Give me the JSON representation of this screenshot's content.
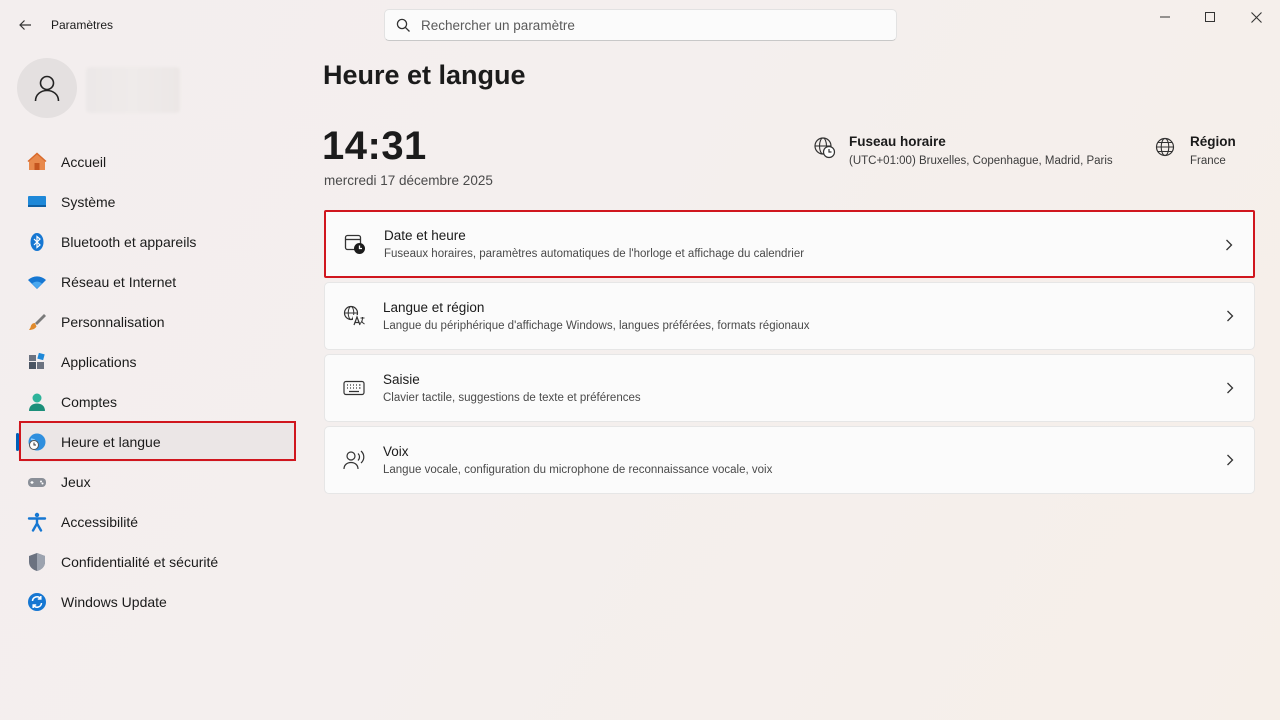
{
  "window": {
    "title": "Paramètres",
    "search_placeholder": "Rechercher un paramètre"
  },
  "sidebar": {
    "items": [
      {
        "label": "Accueil",
        "icon": "home-icon"
      },
      {
        "label": "Système",
        "icon": "monitor-icon"
      },
      {
        "label": "Bluetooth et appareils",
        "icon": "bluetooth-icon"
      },
      {
        "label": "Réseau et Internet",
        "icon": "wifi-icon"
      },
      {
        "label": "Personnalisation",
        "icon": "brush-icon"
      },
      {
        "label": "Applications",
        "icon": "apps-icon"
      },
      {
        "label": "Comptes",
        "icon": "person-icon"
      },
      {
        "label": "Heure et langue",
        "icon": "globe-clock-icon",
        "active": true
      },
      {
        "label": "Jeux",
        "icon": "gamepad-icon"
      },
      {
        "label": "Accessibilité",
        "icon": "accessibility-icon"
      },
      {
        "label": "Confidentialité et sécurité",
        "icon": "shield-icon"
      },
      {
        "label": "Windows Update",
        "icon": "update-icon"
      }
    ]
  },
  "main": {
    "title": "Heure et langue",
    "time": "14:31",
    "date": "mercredi 17 décembre 2025",
    "timezone": {
      "title": "Fuseau horaire",
      "value": "(UTC+01:00) Bruxelles, Copenhague, Madrid, Paris"
    },
    "region": {
      "title": "Région",
      "value": "France"
    },
    "cards": [
      {
        "title": "Date et heure",
        "subtitle": "Fuseaux horaires, paramètres automatiques de l'horloge et affichage du calendrier",
        "icon": "calendar-clock-icon"
      },
      {
        "title": "Langue et région",
        "subtitle": "Langue du périphérique d'affichage Windows, langues préférées, formats régionaux",
        "icon": "language-icon"
      },
      {
        "title": "Saisie",
        "subtitle": "Clavier tactile, suggestions de texte et préférences",
        "icon": "keyboard-icon"
      },
      {
        "title": "Voix",
        "subtitle": "Langue vocale, configuration du microphone de reconnaissance vocale, voix",
        "icon": "voice-icon"
      }
    ]
  },
  "colors": {
    "accent": "#005fb8",
    "highlight": "#d0161e"
  }
}
